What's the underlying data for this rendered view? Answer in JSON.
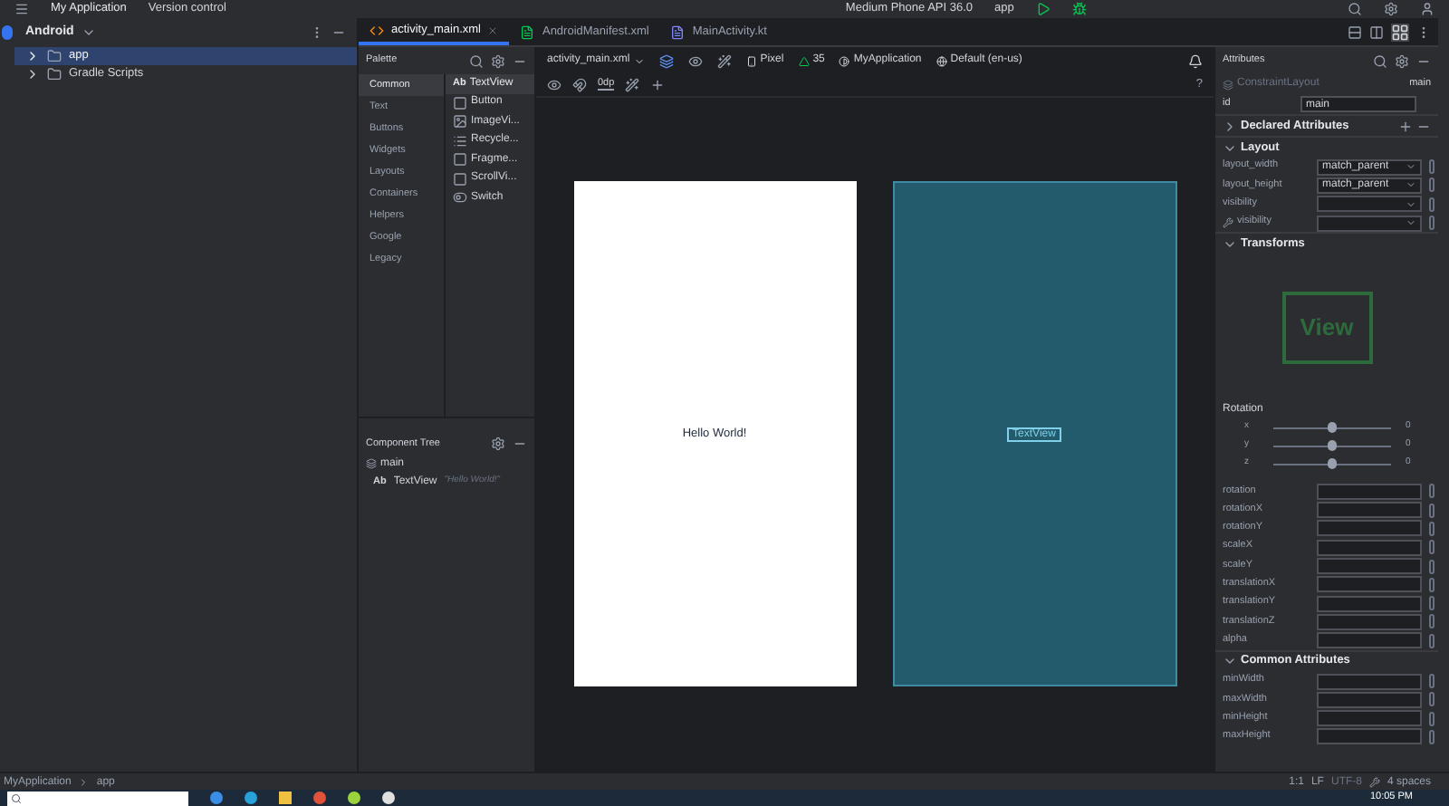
{
  "title_bar": {
    "project": "My Application",
    "vcs": "Version control",
    "device": "Medium Phone API 36.0",
    "run_config": "app"
  },
  "project_panel": {
    "view": "Android",
    "items": [
      {
        "label": "app",
        "selected": true,
        "expanded": false
      },
      {
        "label": "Gradle Scripts",
        "selected": false,
        "expanded": false
      }
    ]
  },
  "editor_tabs": [
    {
      "label": "activity_main.xml",
      "selected": true,
      "kind": "layout"
    },
    {
      "label": "AndroidManifest.xml",
      "selected": false,
      "kind": "manifest"
    },
    {
      "label": "MainActivity.kt",
      "selected": false,
      "kind": "kotlin"
    }
  ],
  "palette": {
    "title": "Palette",
    "categories": [
      {
        "label": "Common",
        "selected": true
      },
      {
        "label": "Text",
        "selected": false
      },
      {
        "label": "Buttons",
        "selected": false
      },
      {
        "label": "Widgets",
        "selected": false
      },
      {
        "label": "Layouts",
        "selected": false
      },
      {
        "label": "Containers",
        "selected": false
      },
      {
        "label": "Helpers",
        "selected": false
      },
      {
        "label": "Google",
        "selected": false
      },
      {
        "label": "Legacy",
        "selected": false
      }
    ],
    "widgets": [
      {
        "kind": "text",
        "glyph": "Ab",
        "label": "TextView",
        "selected": true
      },
      {
        "kind": "button",
        "label": "Button",
        "selected": false
      },
      {
        "kind": "image",
        "label": "ImageVi...",
        "selected": false
      },
      {
        "kind": "list",
        "label": "Recycle...",
        "selected": false
      },
      {
        "kind": "frame",
        "label": "Fragme...",
        "selected": false
      },
      {
        "kind": "frame",
        "label": "ScrollVi...",
        "selected": false
      },
      {
        "kind": "switch",
        "label": "Switch",
        "selected": false
      }
    ]
  },
  "component_tree": {
    "title": "Component Tree",
    "root": {
      "label": "main",
      "children": [
        {
          "glyph": "Ab",
          "label": "TextView",
          "hint": "\"Hello World!\""
        }
      ]
    }
  },
  "design_toolbar": {
    "file": "activity_main.xml",
    "device": "Pixel",
    "api": "35",
    "theme": "MyApplication",
    "locale": "Default (en-us)",
    "margin": "0dp",
    "help": "?"
  },
  "canvas": {
    "design_text": "Hello World!",
    "blueprint_text": "TextView"
  },
  "attributes": {
    "title": "Attributes",
    "class_name": "ConstraintLayout",
    "class_id": "main",
    "id_label": "id",
    "id_value": "main",
    "declared": "Declared Attributes",
    "layout_title": "Layout",
    "layout_rows": [
      {
        "kind": "plain",
        "label": "layout_width",
        "value": "match_parent"
      },
      {
        "kind": "plain",
        "label": "layout_height",
        "value": "match_parent"
      },
      {
        "kind": "plain",
        "label": "visibility"
      },
      {
        "kind": "tools",
        "label": "visibility"
      }
    ],
    "transforms_title": "Transforms",
    "preview": "View",
    "rotation_title": "Rotation",
    "rotation_axes": [
      {
        "label": "x",
        "value": "0",
        "level": 0.5
      },
      {
        "label": "y",
        "value": "0",
        "level": 0.5
      },
      {
        "label": "z",
        "value": "0",
        "level": 0.5
      }
    ],
    "transform_rows": [
      "rotation",
      "rotationX",
      "rotationY",
      "scaleX",
      "scaleY",
      "translationX",
      "translationY",
      "translationZ",
      "alpha"
    ],
    "common_title": "Common Attributes",
    "common_rows": [
      "minWidth",
      "maxWidth",
      "minHeight",
      "maxHeight"
    ]
  },
  "status_bar": {
    "breadcrumbs": [
      "MyApplication",
      "app"
    ],
    "position": "1:1",
    "line_separator": "LF",
    "encoding": "UTF-8",
    "indent": "4 spaces"
  },
  "taskbar": {
    "time": "10:05 PM"
  }
}
